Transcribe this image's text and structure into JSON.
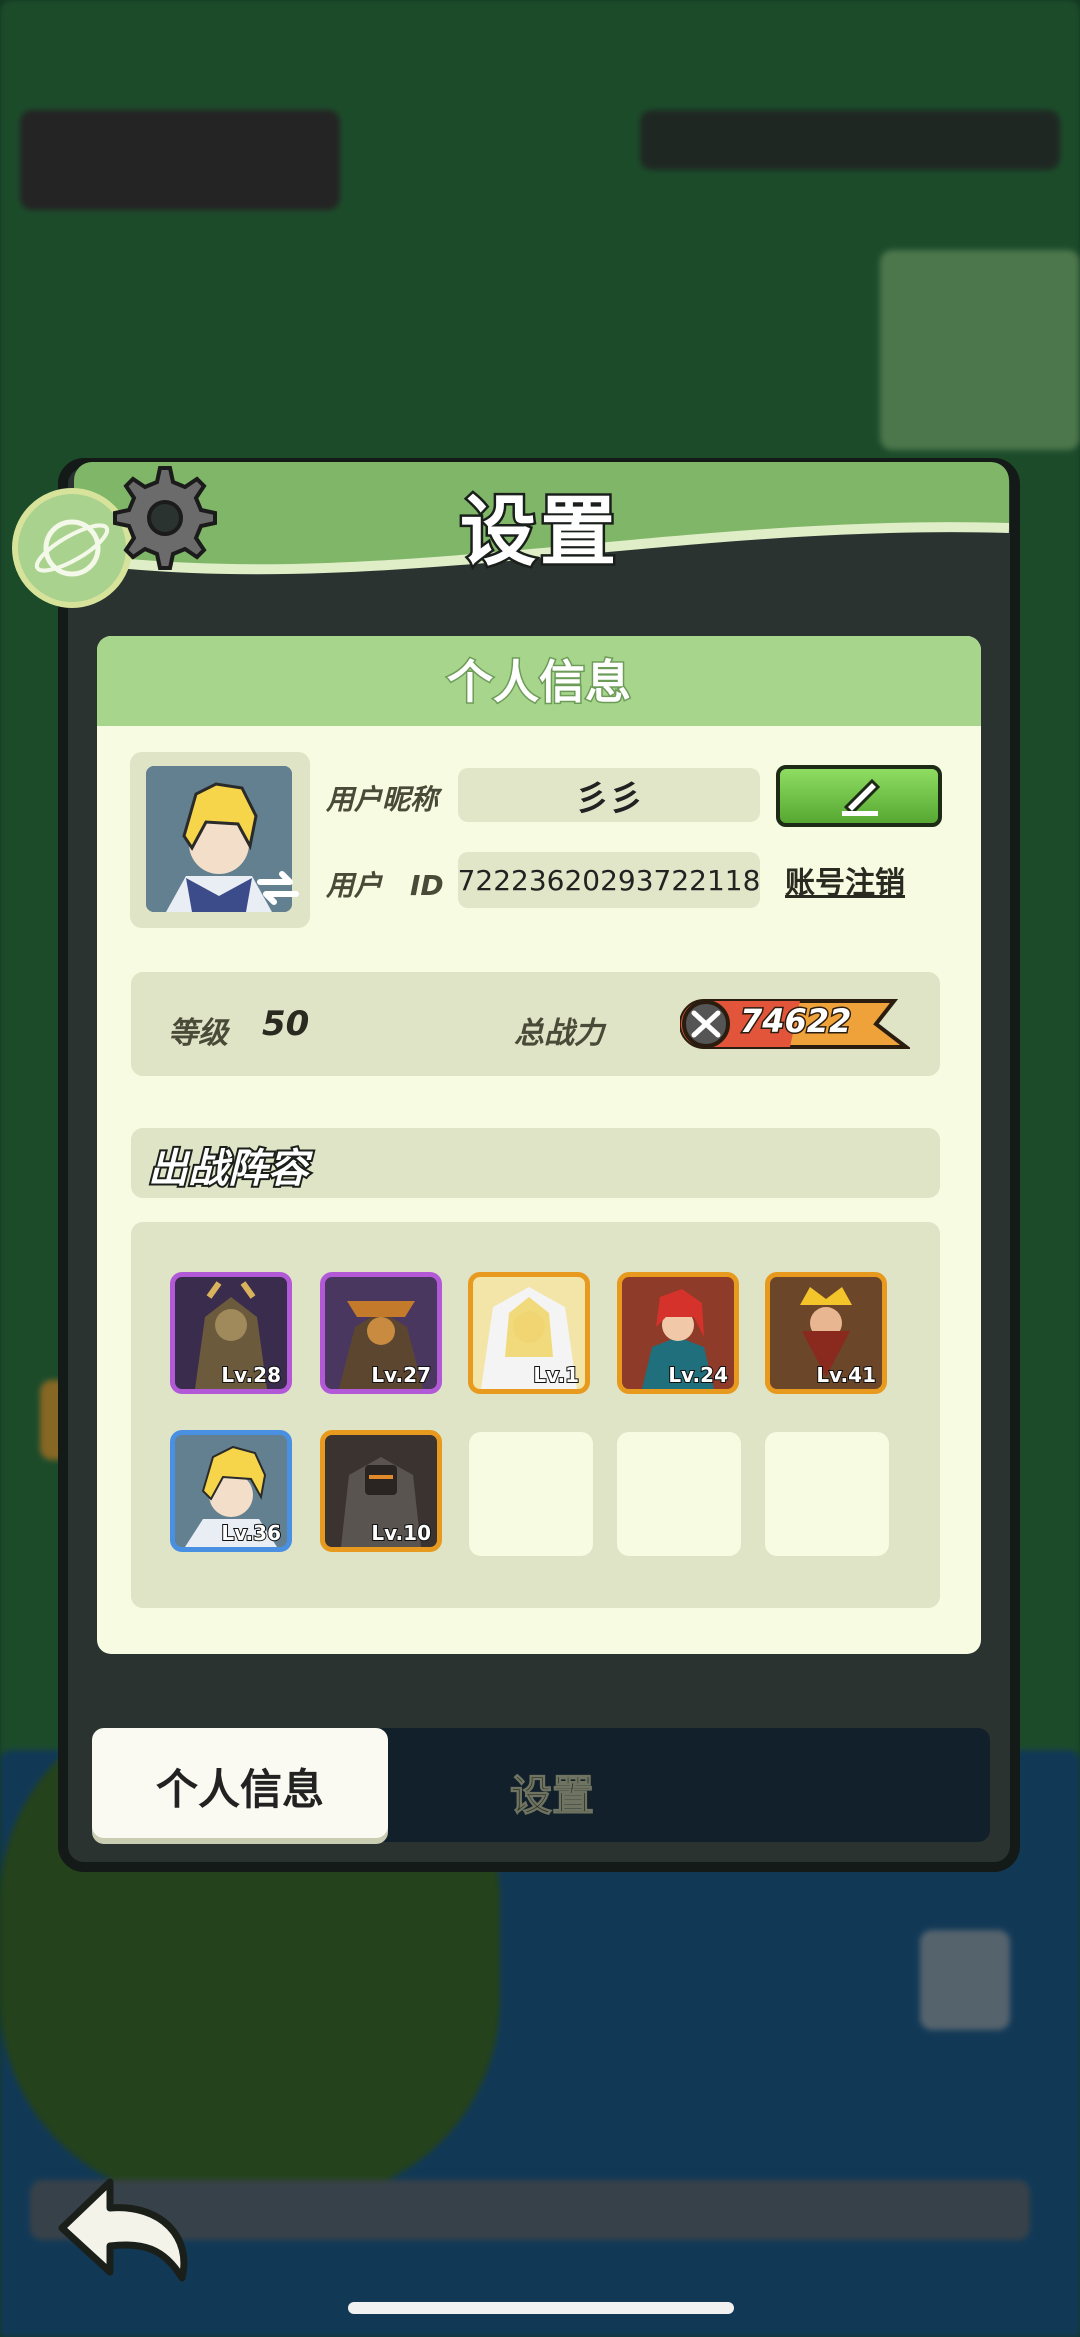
{
  "dialog": {
    "title": "设置"
  },
  "profile_panel": {
    "title": "个人信息",
    "nickname_label": "用户昵称",
    "nickname_value": "彡彡",
    "id_label": "用户　ID",
    "id_value": "72223620293722118",
    "edit_icon": "pencil-icon",
    "delete_account_link": "账号注销"
  },
  "stats": {
    "level_label": "等级",
    "level_value": "50",
    "power_label": "总战力",
    "power_value": "74622"
  },
  "lineup": {
    "title": "出战阵容",
    "heroes": [
      {
        "level": "Lv.28",
        "rarity": "purple"
      },
      {
        "level": "Lv.27",
        "rarity": "purple"
      },
      {
        "level": "Lv.1",
        "rarity": "orange"
      },
      {
        "level": "Lv.24",
        "rarity": "orange"
      },
      {
        "level": "Lv.41",
        "rarity": "orange"
      },
      {
        "level": "Lv.36",
        "rarity": "blue"
      },
      {
        "level": "Lv.10",
        "rarity": "orange"
      }
    ],
    "empty_slots": 3
  },
  "tabs": {
    "profile": "个人信息",
    "settings": "设置"
  },
  "colors": {
    "purple_frame": "#b259d8",
    "orange_frame": "#e79a1d",
    "blue_frame": "#4a90e2",
    "header_green": "#7fb668",
    "panel_bg": "#f6fbe1"
  }
}
